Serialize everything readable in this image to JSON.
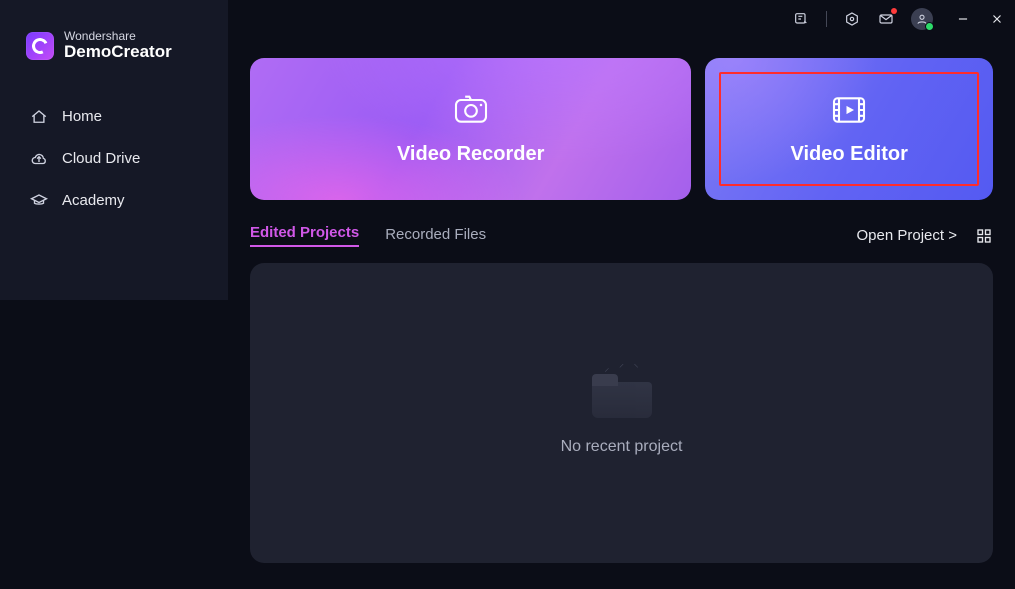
{
  "brand": {
    "line1": "Wondershare",
    "line2": "DemoCreator"
  },
  "sidebar": {
    "items": [
      {
        "label": "Home",
        "icon": "home-icon"
      },
      {
        "label": "Cloud Drive",
        "icon": "cloud-upload-icon"
      },
      {
        "label": "Academy",
        "icon": "graduation-cap-icon"
      }
    ]
  },
  "cards": {
    "recorder_label": "Video Recorder",
    "editor_label": "Video Editor"
  },
  "tabs": {
    "edited_projects": "Edited Projects",
    "recorded_files": "Recorded Files",
    "open_project": "Open Project  >"
  },
  "panel": {
    "empty_text": "No recent project"
  },
  "titlebar": {
    "feedback_icon": "feedback-icon",
    "settings_icon": "settings-hex-icon",
    "mail_icon": "mail-icon",
    "avatar_icon": "user-avatar-icon",
    "minimize_icon": "minimize-icon",
    "close_icon": "close-icon"
  }
}
